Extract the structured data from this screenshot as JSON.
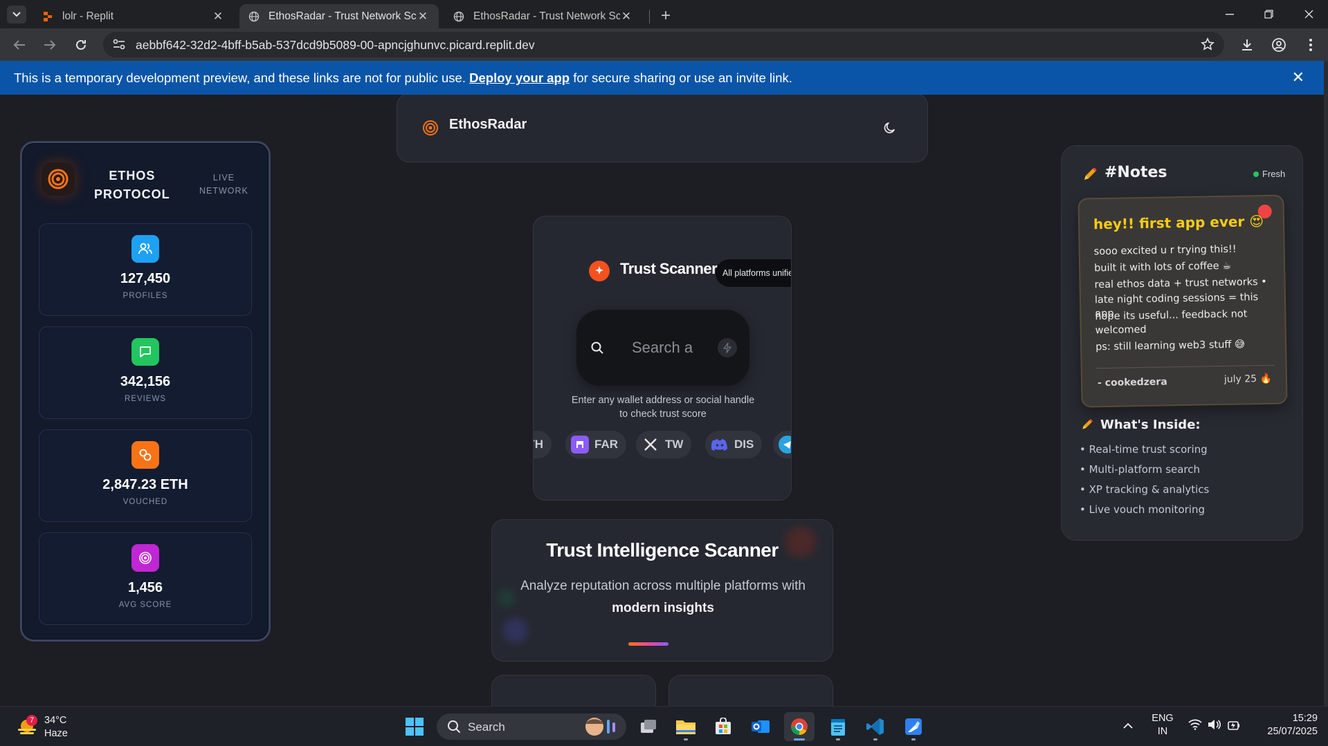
{
  "browser": {
    "tabs": [
      {
        "title": "lolr - Replit",
        "active": false
      },
      {
        "title": "EthosRadar - Trust Network Sca",
        "active": true
      },
      {
        "title": "EthosRadar - Trust Network Sca",
        "active": false
      }
    ],
    "url": "aebbf642-32d2-4bff-b5ab-537dcd9b5089-00-apncjghunvc.picard.replit.dev",
    "icons": [
      "back-arrow-icon",
      "forward-arrow-icon",
      "reload-icon",
      "site-info-icon",
      "star-icon",
      "download-icon",
      "profile-icon",
      "kebab-menu-icon"
    ]
  },
  "banner": {
    "text_before": "This is a temporary development preview, and these links are not for public use.",
    "link": "Deploy your app",
    "text_after": "for secure sharing or use an invite link.",
    "color": "#0b55a8"
  },
  "stats_panel": {
    "brand_line1": "ETHOS",
    "brand_line2": "PROTOCOL",
    "live_line1": "LIVE",
    "live_line2": "NETWORK",
    "stats": [
      {
        "value": "127,450",
        "label": "PROFILES",
        "icon": "users-icon",
        "color": "#1ea1f2"
      },
      {
        "value": "342,156",
        "label": "REVIEWS",
        "icon": "chat-bubble-icon",
        "color": "#22c55e"
      },
      {
        "value": "2,847.23 ETH",
        "label": "VOUCHED",
        "icon": "link-icon",
        "color": "#f97316"
      },
      {
        "value": "1,456",
        "label": "AVG SCORE",
        "icon": "target-icon",
        "color": "#c026d3"
      }
    ]
  },
  "header": {
    "title": "EthosRadar",
    "icon": "radar-logo-icon",
    "theme_toggle_icon": "moon-icon"
  },
  "scanner": {
    "title": "Trust Scanner",
    "badge": "All platforms unified",
    "search_placeholder": "Search a",
    "hint": "Enter any wallet address or social handle to check trust score",
    "chips": [
      {
        "label": "TH",
        "icon": "ethereum-icon"
      },
      {
        "label": "FAR",
        "icon": "farcaster-icon",
        "color": "#8b5cf6"
      },
      {
        "label": "TW",
        "icon": "x-twitter-icon"
      },
      {
        "label": "DIS",
        "icon": "discord-icon",
        "color": "#5865f2"
      },
      {
        "label": "",
        "icon": "telegram-icon",
        "color": "#2aa3df"
      }
    ]
  },
  "intel": {
    "title": "Trust Intelligence Scanner",
    "subtitle": "Analyze reputation across multiple platforms with",
    "subtitle_bold": "modern insights"
  },
  "notes": {
    "title": "#Notes",
    "status": "Fresh",
    "sticky": {
      "heading": "hey!! first app ever 😍",
      "lines": [
        "sooo excited u r trying this!!",
        "built it with lots of coffee ☕",
        "real ethos data + trust networks •",
        "late night coding sessions = this app",
        "hope its useful... feedback not welcomed",
        "ps: still learning web3 stuff 😅"
      ],
      "signature": "- cookedzera",
      "date": "july 25 🔥"
    },
    "whats_inside_title": "What's Inside:",
    "items": [
      "• Real-time trust scoring",
      "• Multi-platform search",
      "• XP tracking & analytics",
      "• Live vouch monitoring"
    ]
  },
  "taskbar": {
    "weather_temp": "34°C",
    "weather_desc": "Haze",
    "weather_badge": "7",
    "search_label": "Search",
    "apps": [
      "windows-start-icon",
      "task-view-icon",
      "file-explorer-icon",
      "microsoft-store-icon",
      "outlook-icon",
      "chrome-icon",
      "notepad-icon",
      "vscode-icon",
      "paint-icon"
    ],
    "lang_line1": "ENG",
    "lang_line2": "IN",
    "time": "15:29",
    "date": "25/07/2025"
  }
}
